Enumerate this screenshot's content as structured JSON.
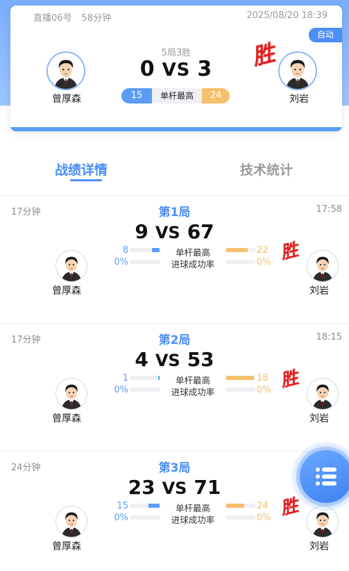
{
  "header": {
    "room": "直播06号",
    "duration": "58分钟",
    "datetime": "2025/08/20 18:39",
    "mode_badge": "自动",
    "rule": "5局3胜",
    "left_player": {
      "name": "曾厚森",
      "score": "0",
      "high_break": "15"
    },
    "right_player": {
      "name": "刘岩",
      "score": "3",
      "high_break": "24"
    },
    "vs": "VS",
    "high_break_label": "单杆最高",
    "win_mark": "胜"
  },
  "tabs": {
    "active": "战绩详情",
    "inactive": "技术统计"
  },
  "stat_labels": {
    "high_break": "单杆最高",
    "pot_rate": "进球成功率"
  },
  "games": [
    {
      "title": "第1局",
      "duration": "17分钟",
      "end_time": "17:58",
      "left_score": "9",
      "right_score": "67",
      "vs": "VS",
      "left_high_break": "8",
      "right_high_break": "22",
      "left_high_break_fill": 0.27,
      "right_high_break_fill": 0.73,
      "left_pot_rate": "0%",
      "right_pot_rate": "0%",
      "left_name": "曾厚森",
      "right_name": "刘岩",
      "winner_mark": "胜"
    },
    {
      "title": "第2局",
      "duration": "17分钟",
      "end_time": "18:15",
      "left_score": "4",
      "right_score": "53",
      "vs": "VS",
      "left_high_break": "1",
      "right_high_break": "18",
      "left_high_break_fill": 0.05,
      "right_high_break_fill": 0.95,
      "left_pot_rate": "0%",
      "right_pot_rate": "0%",
      "left_name": "曾厚森",
      "right_name": "刘岩",
      "winner_mark": "胜"
    },
    {
      "title": "第3局",
      "duration": "24分钟",
      "end_time": "",
      "left_score": "23",
      "right_score": "71",
      "vs": "VS",
      "left_high_break": "15",
      "right_high_break": "24",
      "left_high_break_fill": 0.38,
      "right_high_break_fill": 0.62,
      "left_pot_rate": "0%",
      "right_pot_rate": "0%",
      "left_name": "曾厚森",
      "right_name": "刘岩",
      "winner_mark": "胜"
    }
  ],
  "fab": {
    "icon": "list-menu-icon"
  },
  "colors": {
    "accent_blue": "#4c8ef5",
    "accent_orange": "#f6c06c",
    "win_red": "#e02020"
  }
}
